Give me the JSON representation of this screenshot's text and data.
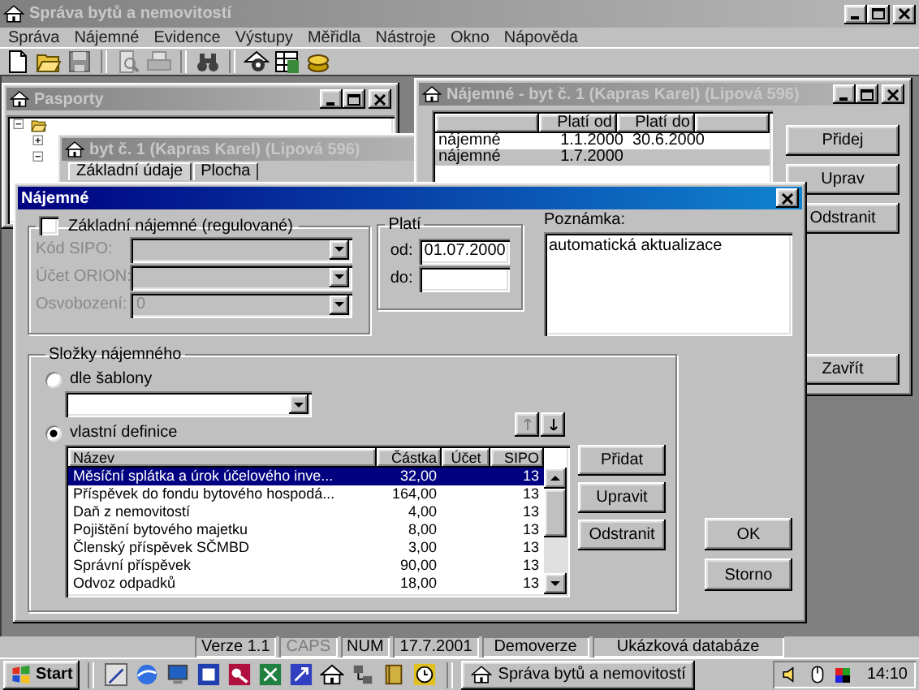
{
  "app": {
    "title": "Správa bytů a nemovitostí",
    "menu": [
      "Správa",
      "Nájemné",
      "Evidence",
      "Výstupy",
      "Měřidla",
      "Nástroje",
      "Okno",
      "Nápověda"
    ]
  },
  "pasporty_window": {
    "title": "Pasporty"
  },
  "flat_window": {
    "title": "byt č. 1 (Kapras Karel) (Lipová 596)",
    "tabs": [
      {
        "label": "Základní údaje",
        "selected": true
      },
      {
        "label": "Plocha",
        "selected": false
      }
    ]
  },
  "rent_window": {
    "title": "Nájemné - byt č. 1 (Kapras Karel) (Lipová 596)",
    "columns": [
      "Platí od",
      "Platí do"
    ],
    "rows": [
      {
        "name": "nájemné",
        "from": "1.1.2000",
        "to": "30.6.2000",
        "selected": false
      },
      {
        "name": "nájemné",
        "from": "1.7.2000",
        "selected": true
      }
    ],
    "buttons": [
      "Přidej",
      "Uprav",
      "Odstranit"
    ],
    "close_button": "Zavřít"
  },
  "dialog": {
    "title": "Nájemné",
    "basic_rent": {
      "label": "Základní nájemné (regulované)",
      "checked": false,
      "fields": [
        {
          "label": "Kód SIPO:",
          "disabled": true
        },
        {
          "label": "Účet ORION:",
          "disabled": true
        },
        {
          "label": "Osvobození:",
          "value": "0",
          "disabled": true
        }
      ]
    },
    "valid": {
      "label": "Platí",
      "from_label": "od:",
      "from_value": "01.07.2000",
      "to_label": "do:"
    },
    "note": {
      "label": "Poznámka:",
      "value": "automatická aktualizace"
    },
    "components": {
      "label": "Složky nájemného",
      "options": [
        {
          "label": "dle šablony",
          "selected": false
        },
        {
          "label": "vlastní definice",
          "selected": true
        }
      ],
      "columns": [
        "Název",
        "Částka",
        "Účet",
        "SIPO"
      ],
      "rows": [
        {
          "name": "Měsíční splátka a úrok účelového inve...",
          "amount": "32,00",
          "sipo": "13",
          "selected": true
        },
        {
          "name": "Příspěvek do fondu bytového hospodá...",
          "amount": "164,00",
          "sipo": "13",
          "selected": false
        },
        {
          "name": "Daň z nemovitostí",
          "amount": "4,00",
          "sipo": "13",
          "selected": false
        },
        {
          "name": "Pojištění bytového majetku",
          "amount": "8,00",
          "sipo": "13",
          "selected": false
        },
        {
          "name": "Členský příspěvek SČMBD",
          "amount": "3,00",
          "sipo": "13",
          "selected": false
        },
        {
          "name": "Správní příspěvek",
          "amount": "90,00",
          "sipo": "13",
          "selected": false
        },
        {
          "name": "Odvoz odpadků",
          "amount": "18,00",
          "sipo": "13",
          "selected": false
        }
      ],
      "buttons": [
        "Přidat",
        "Upravit",
        "Odstranit"
      ]
    },
    "buttons": [
      "OK",
      "Storno"
    ]
  },
  "status_bar": [
    {
      "text": "Verze 1.1",
      "disabled": false
    },
    {
      "text": "CAPS",
      "disabled": true
    },
    {
      "text": "NUM",
      "disabled": false
    },
    {
      "text": "17.7.2001",
      "disabled": false
    },
    {
      "text": "Demoverze",
      "disabled": false
    },
    {
      "text": "Ukázková databáze",
      "disabled": false
    }
  ],
  "taskbar": {
    "start": "Start",
    "task": "Správa bytů a nemovitostí",
    "clock": "14:10"
  }
}
